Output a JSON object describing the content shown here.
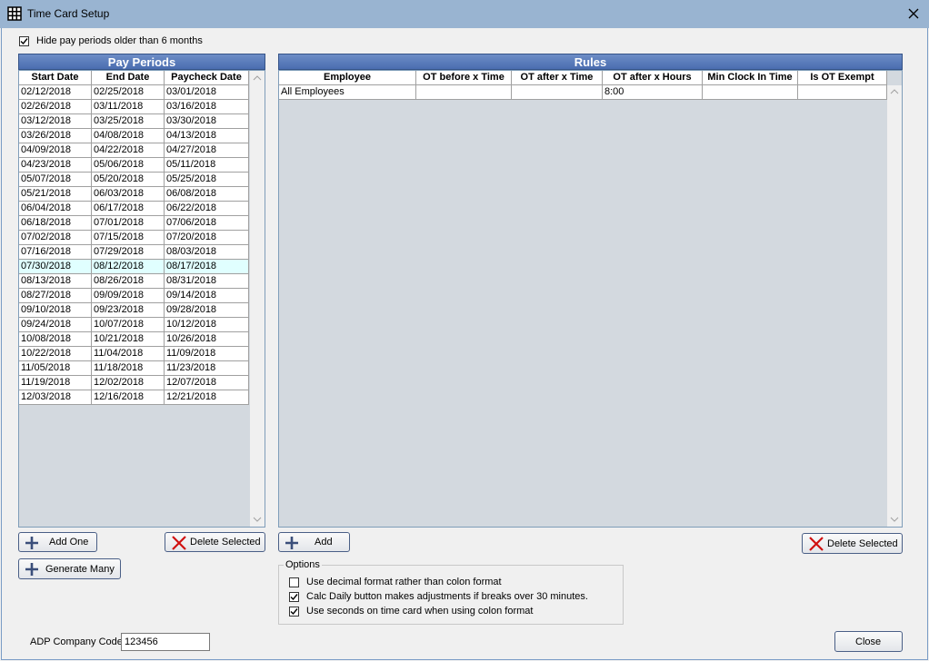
{
  "window": {
    "title": "Time Card Setup",
    "icon": "grid-table-icon",
    "close_icon": "close-x-icon"
  },
  "hide_old_periods": {
    "label": "Hide pay periods older than 6 months",
    "checked": true
  },
  "pay_periods": {
    "header": "Pay Periods",
    "columns": [
      "Start Date",
      "End Date",
      "Paycheck Date"
    ],
    "rows": [
      [
        "02/12/2018",
        "02/25/2018",
        "03/01/2018"
      ],
      [
        "02/26/2018",
        "03/11/2018",
        "03/16/2018"
      ],
      [
        "03/12/2018",
        "03/25/2018",
        "03/30/2018"
      ],
      [
        "03/26/2018",
        "04/08/2018",
        "04/13/2018"
      ],
      [
        "04/09/2018",
        "04/22/2018",
        "04/27/2018"
      ],
      [
        "04/23/2018",
        "05/06/2018",
        "05/11/2018"
      ],
      [
        "05/07/2018",
        "05/20/2018",
        "05/25/2018"
      ],
      [
        "05/21/2018",
        "06/03/2018",
        "06/08/2018"
      ],
      [
        "06/04/2018",
        "06/17/2018",
        "06/22/2018"
      ],
      [
        "06/18/2018",
        "07/01/2018",
        "07/06/2018"
      ],
      [
        "07/02/2018",
        "07/15/2018",
        "07/20/2018"
      ],
      [
        "07/16/2018",
        "07/29/2018",
        "08/03/2018"
      ],
      [
        "07/30/2018",
        "08/12/2018",
        "08/17/2018"
      ],
      [
        "08/13/2018",
        "08/26/2018",
        "08/31/2018"
      ],
      [
        "08/27/2018",
        "09/09/2018",
        "09/14/2018"
      ],
      [
        "09/10/2018",
        "09/23/2018",
        "09/28/2018"
      ],
      [
        "09/24/2018",
        "10/07/2018",
        "10/12/2018"
      ],
      [
        "10/08/2018",
        "10/21/2018",
        "10/26/2018"
      ],
      [
        "10/22/2018",
        "11/04/2018",
        "11/09/2018"
      ],
      [
        "11/05/2018",
        "11/18/2018",
        "11/23/2018"
      ],
      [
        "11/19/2018",
        "12/02/2018",
        "12/07/2018"
      ],
      [
        "12/03/2018",
        "12/16/2018",
        "12/21/2018"
      ]
    ],
    "selected_row_index": 12,
    "selected_row_color": "#e0ffff"
  },
  "rules": {
    "header": "Rules",
    "columns": [
      "Employee",
      "OT before x Time",
      "OT after x Time",
      "OT after x Hours",
      "Min Clock In Time",
      "Is OT Exempt"
    ],
    "rows": [
      [
        "All Employees",
        "",
        "",
        "8:00",
        "",
        ""
      ]
    ]
  },
  "buttons": {
    "add_one": "Add One",
    "delete_selected_periods": "Delete Selected",
    "generate_many": "Generate Many",
    "add_rule": "Add",
    "delete_selected_rules": "Delete Selected",
    "close": "Close"
  },
  "options": {
    "legend": "Options",
    "items": [
      {
        "label": "Use decimal format rather than colon format",
        "checked": false
      },
      {
        "label": "Calc Daily button makes adjustments if breaks over 30 minutes.",
        "checked": true
      },
      {
        "label": "Use seconds on time card when using colon format",
        "checked": true
      }
    ]
  },
  "adp": {
    "label": "ADP Company Code",
    "value": "123456"
  },
  "colors": {
    "panel_header": "#4a6db0",
    "titlebar": "#99b4d1",
    "grid_background": "#d3d9df",
    "plus_icon": "#3a4e7a",
    "delete_x_icon": "#d01010"
  }
}
